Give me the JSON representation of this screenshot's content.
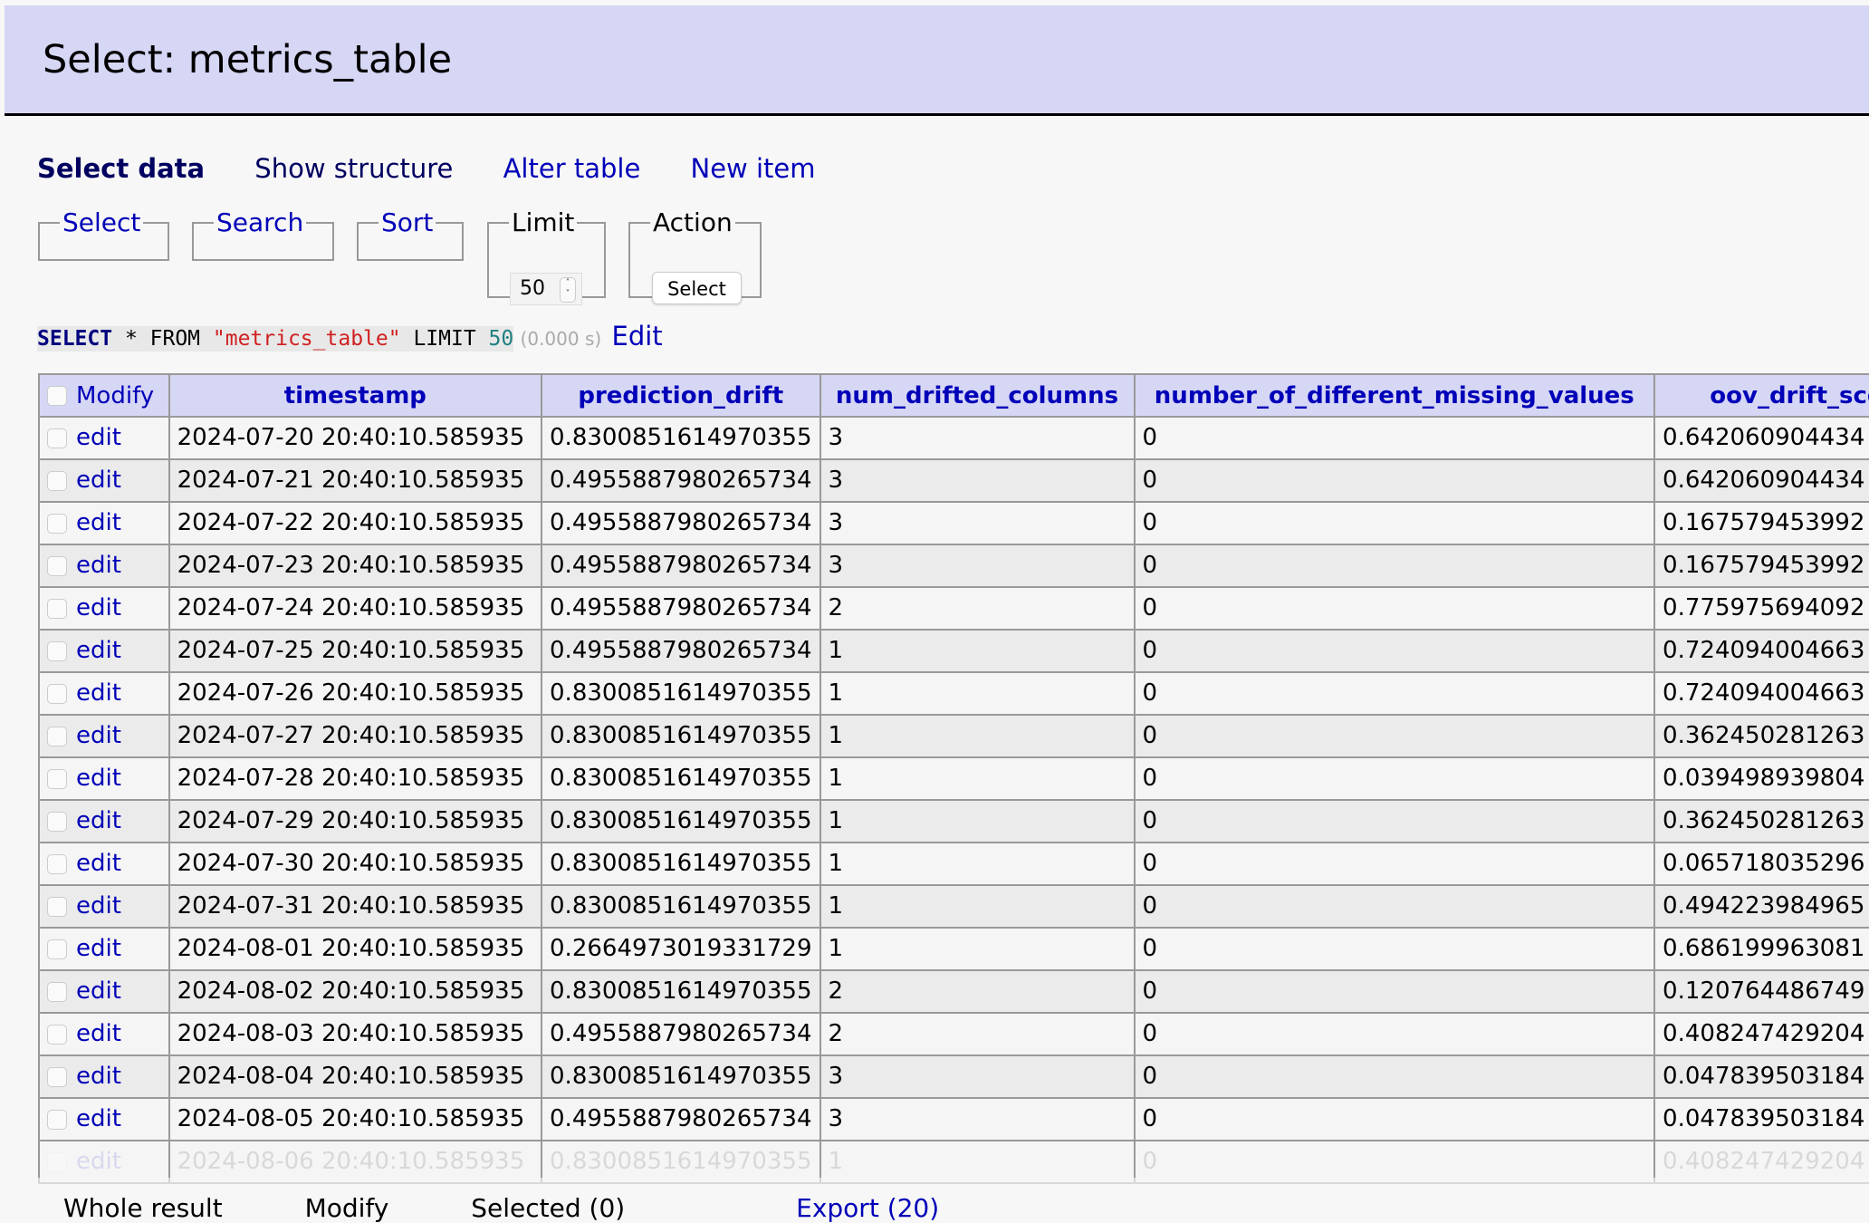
{
  "header": {
    "title": "Select: metrics_table"
  },
  "nav": {
    "select_data": "Select data",
    "show_structure": "Show structure",
    "alter_table": "Alter table",
    "new_item": "New item"
  },
  "fieldsets": {
    "select": "Select",
    "search": "Search",
    "sort": "Sort",
    "limit": "Limit",
    "limit_value": "50",
    "action": "Action",
    "action_button": "Select"
  },
  "sql": {
    "select_kw": "SELECT",
    "star": " * FROM ",
    "table_str": "\"metrics_table\"",
    "limit_kw": " LIMIT ",
    "limit_num": "50",
    "time": "(0.000 s)",
    "edit_label": "Edit"
  },
  "table": {
    "modify_label": "Modify",
    "edit_label": "edit",
    "columns": [
      "timestamp",
      "prediction_drift",
      "num_drifted_columns",
      "number_of_different_missing_values",
      "oov_drift_sco"
    ],
    "rows": [
      [
        "2024-07-20 20:40:10.585935",
        "0.8300851614970355",
        "3",
        "0",
        "0.642060904434"
      ],
      [
        "2024-07-21 20:40:10.585935",
        "0.4955887980265734",
        "3",
        "0",
        "0.642060904434"
      ],
      [
        "2024-07-22 20:40:10.585935",
        "0.4955887980265734",
        "3",
        "0",
        "0.167579453992"
      ],
      [
        "2024-07-23 20:40:10.585935",
        "0.4955887980265734",
        "3",
        "0",
        "0.167579453992"
      ],
      [
        "2024-07-24 20:40:10.585935",
        "0.4955887980265734",
        "2",
        "0",
        "0.775975694092"
      ],
      [
        "2024-07-25 20:40:10.585935",
        "0.4955887980265734",
        "1",
        "0",
        "0.724094004663"
      ],
      [
        "2024-07-26 20:40:10.585935",
        "0.8300851614970355",
        "1",
        "0",
        "0.724094004663"
      ],
      [
        "2024-07-27 20:40:10.585935",
        "0.8300851614970355",
        "1",
        "0",
        "0.362450281263"
      ],
      [
        "2024-07-28 20:40:10.585935",
        "0.8300851614970355",
        "1",
        "0",
        "0.039498939804"
      ],
      [
        "2024-07-29 20:40:10.585935",
        "0.8300851614970355",
        "1",
        "0",
        "0.362450281263"
      ],
      [
        "2024-07-30 20:40:10.585935",
        "0.8300851614970355",
        "1",
        "0",
        "0.065718035296"
      ],
      [
        "2024-07-31 20:40:10.585935",
        "0.8300851614970355",
        "1",
        "0",
        "0.494223984965"
      ],
      [
        "2024-08-01 20:40:10.585935",
        "0.2664973019331729",
        "1",
        "0",
        "0.686199963081"
      ],
      [
        "2024-08-02 20:40:10.585935",
        "0.8300851614970355",
        "2",
        "0",
        "0.120764486749"
      ],
      [
        "2024-08-03 20:40:10.585935",
        "0.4955887980265734",
        "2",
        "0",
        "0.408247429204"
      ],
      [
        "2024-08-04 20:40:10.585935",
        "0.8300851614970355",
        "3",
        "0",
        "0.047839503184"
      ],
      [
        "2024-08-05 20:40:10.585935",
        "0.4955887980265734",
        "3",
        "0",
        "0.047839503184"
      ],
      [
        "2024-08-06 20:40:10.585935",
        "0.8300851614970355",
        "1",
        "0",
        "0.408247429204"
      ]
    ]
  },
  "footer": {
    "whole_result": "Whole result",
    "modify": "Modify",
    "selected": "Selected (0)",
    "export": "Export (20)"
  }
}
